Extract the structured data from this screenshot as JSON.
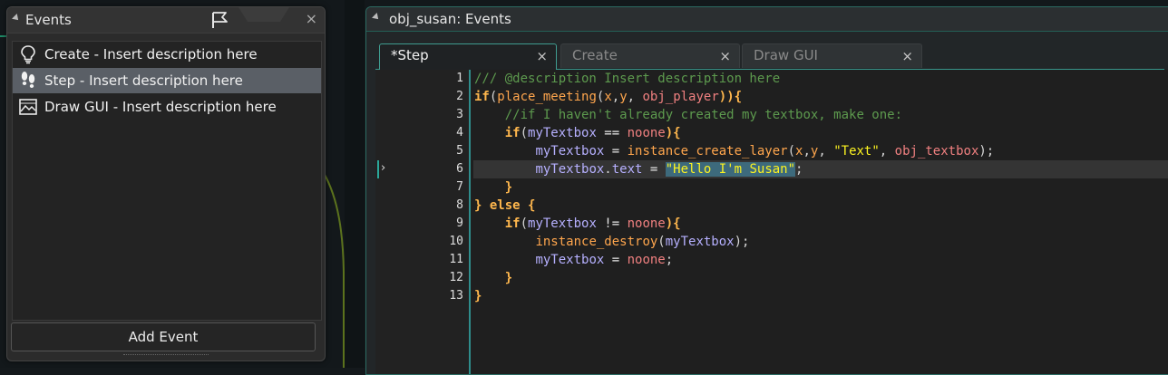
{
  "events_panel": {
    "title": "Events",
    "close_glyph": "×",
    "items": [
      {
        "label": "Create - Insert description here",
        "icon": "lightbulb-icon",
        "selected": false
      },
      {
        "label": "Step - Insert description here",
        "icon": "footsteps-icon",
        "selected": true
      },
      {
        "label": "Draw GUI - Insert description here",
        "icon": "picture-icon",
        "selected": false
      }
    ],
    "add_event_label": "Add Event"
  },
  "editor": {
    "title": "obj_susan: Events",
    "tabs": [
      {
        "label": "*Step",
        "active": true,
        "close": "×"
      },
      {
        "label": "Create",
        "active": false,
        "close": "×"
      },
      {
        "label": "Draw GUI",
        "active": false,
        "close": "×"
      }
    ],
    "current_line": 6,
    "line_numbers": [
      "1",
      "2",
      "3",
      "4",
      "5",
      "6",
      "7",
      "8",
      "9",
      "10",
      "11",
      "12",
      "13"
    ],
    "code": {
      "l1": "/// @description Insert description here",
      "l2": {
        "kw": "if",
        "p1": "(",
        "fn": "place_meeting",
        "p2": "(",
        "a1": "x",
        "c1": ",",
        "a2": "y",
        "c2": ", ",
        "a3": "obj_player",
        "p3": ")){"
      },
      "l3": "//if I haven't already created my textbox, make one:",
      "l4": {
        "kw": "if",
        "p1": "(",
        "v1": "myTextbox",
        "op": " == ",
        "c1": "noone",
        "p2": "){"
      },
      "l5": {
        "v1": "myTextbox",
        "op": " = ",
        "fn": "instance_create_layer",
        "p1": "(",
        "a1": "x",
        "c1": ",",
        "a2": "y",
        "c2": ", ",
        "s1": "\"Text\"",
        "c3": ", ",
        "a3": "obj_textbox",
        "p2": ");"
      },
      "l6": {
        "v1": "myTextbox",
        "dot": ".",
        "v2": "text",
        "op": " = ",
        "s1": "\"Hello I'm Susan\"",
        "end": ";"
      },
      "l7": "}",
      "l8": {
        "p1": "} ",
        "kw": "else",
        "p2": " {"
      },
      "l9": {
        "kw": "if",
        "p1": "(",
        "v1": "myTextbox",
        "op": " != ",
        "c1": "noone",
        "p2": "){"
      },
      "l10": {
        "fn": "instance_destroy",
        "p1": "(",
        "v1": "myTextbox",
        "p2": ");"
      },
      "l11": {
        "v1": "myTextbox",
        "op": " = ",
        "c1": "noone",
        "p2": ";"
      },
      "l12": "}",
      "l13": "}"
    }
  }
}
